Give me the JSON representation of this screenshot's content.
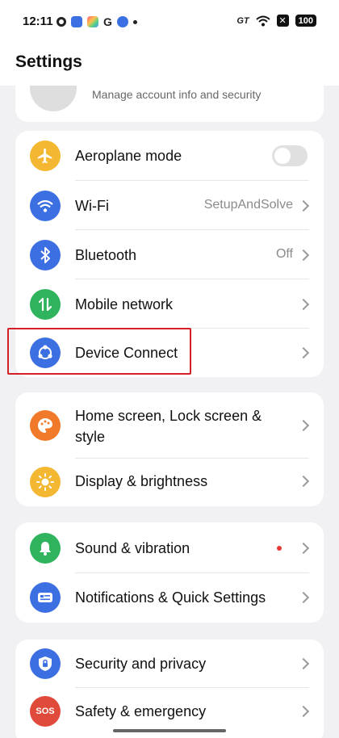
{
  "status_bar": {
    "time": "12:11",
    "battery": "100"
  },
  "header": {
    "title": "Settings"
  },
  "account": {
    "subtitle": "Manage account info and security"
  },
  "groups": [
    {
      "items": [
        {
          "label": "Aeroplane mode",
          "icon": "airplane-icon",
          "color": "#f3b731",
          "toggle": "off"
        },
        {
          "label": "Wi-Fi",
          "value": "SetupAndSolve",
          "icon": "wifi-icon",
          "color": "#3b6fe2"
        },
        {
          "label": "Bluetooth",
          "value": "Off",
          "icon": "bluetooth-icon",
          "color": "#3b6fe2"
        },
        {
          "label": "Mobile network",
          "icon": "mobile-network-icon",
          "color": "#2fb35c"
        },
        {
          "label": "Device Connect",
          "icon": "device-connect-icon",
          "color": "#3b6fe2"
        }
      ]
    },
    {
      "items": [
        {
          "label": "Home screen, Lock screen & style",
          "icon": "palette-icon",
          "color": "#f07a2a"
        },
        {
          "label": "Display & brightness",
          "icon": "sun-icon",
          "color": "#f3b731"
        }
      ]
    },
    {
      "items": [
        {
          "label": "Sound & vibration",
          "icon": "bell-icon",
          "color": "#2fb35c",
          "badge_color": "#e53935"
        },
        {
          "label": "Notifications & Quick Settings",
          "icon": "notification-icon",
          "color": "#3b6fe2"
        }
      ]
    },
    {
      "items": [
        {
          "label": "Security and privacy",
          "icon": "lock-icon",
          "color": "#3b6fe2"
        },
        {
          "label": "Safety & emergency",
          "icon": "sos-icon",
          "color": "#e04a3a",
          "icon_text": "SOS"
        }
      ]
    }
  ]
}
